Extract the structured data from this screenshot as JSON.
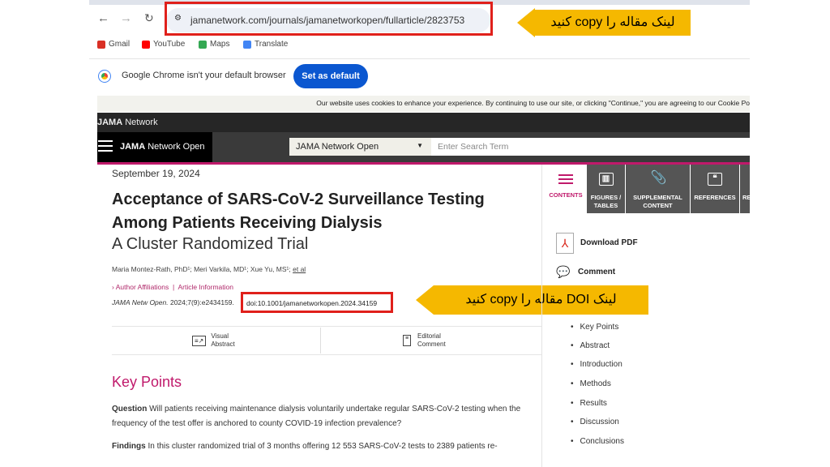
{
  "browser": {
    "url": "jamanetwork.com/journals/jamanetworkopen/fullarticle/2823753",
    "bookmarks": [
      {
        "label": "Gmail",
        "color": "#d93025"
      },
      {
        "label": "YouTube",
        "color": "#ff0000"
      },
      {
        "label": "Maps",
        "color": "#34a853"
      },
      {
        "label": "Translate",
        "color": "#4285f4"
      }
    ],
    "default_msg": "Google Chrome isn't your default browser",
    "set_default": "Set as default"
  },
  "site": {
    "cookie": "Our website uses cookies to enhance your experience. By continuing to use our site, or clicking \"Continue,\" you are agreeing to our Cookie Po",
    "network": "JAMA Network",
    "network_bold": "JAMA",
    "journal_bold": "JAMA",
    "journal_rest": "Network Open",
    "select": "JAMA Network Open",
    "search_placeholder": "Enter Search Term",
    "accent": "#c0196b"
  },
  "article": {
    "date": "September 19, 2024",
    "title_line1": "Acceptance of SARS-CoV-2 Surveillance Testing",
    "title_line2": "Among Patients Receiving Dialysis",
    "subtitle": "A Cluster Randomized Trial",
    "authors": "Maria Montez-Rath, PhD¹; Meri Varkila, MD¹; Xue Yu, MS¹;",
    "et_al": "et al",
    "affiliations": "Author Affiliations",
    "article_info": "Article Information",
    "citation_journal": "JAMA Netw Open.",
    "citation": " 2024;7(9):e2434159.",
    "doi": "doi:10.1001/jamanetworkopen.2024.34159",
    "visual_abstract": [
      "Visual",
      "Abstract"
    ],
    "editorial_comment": [
      "Editorial",
      "Comment"
    ],
    "key_points_heading": "Key Points",
    "question_label": "Question",
    "question": " Will patients receiving maintenance dialysis voluntarily undertake regular SARS-CoV-2 testing when the frequency of the test offer is anchored to county COVID-19 infection prevalence?",
    "findings_label": "Findings",
    "findings": "  In this cluster randomized trial of 3 months offering 12 553 SARS-CoV-2 tests to 2389 patients re-"
  },
  "sidebar": {
    "tabs": [
      {
        "label": "CONTENTS"
      },
      {
        "label": "FIGURES / TABLES"
      },
      {
        "label": "SUPPLEMENTAL CONTENT"
      },
      {
        "label": "REFERENCES"
      },
      {
        "label": "RE"
      }
    ],
    "download_pdf": "Download PDF",
    "comment": "Comment",
    "toc": [
      "Key Points",
      "Abstract",
      "Introduction",
      "Methods",
      "Results",
      "Discussion",
      "Conclusions"
    ]
  },
  "annotations": {
    "url_note": "لینک مقاله را copy کنید",
    "doi_note": "لینک DOI مقاله را copy کنید"
  }
}
